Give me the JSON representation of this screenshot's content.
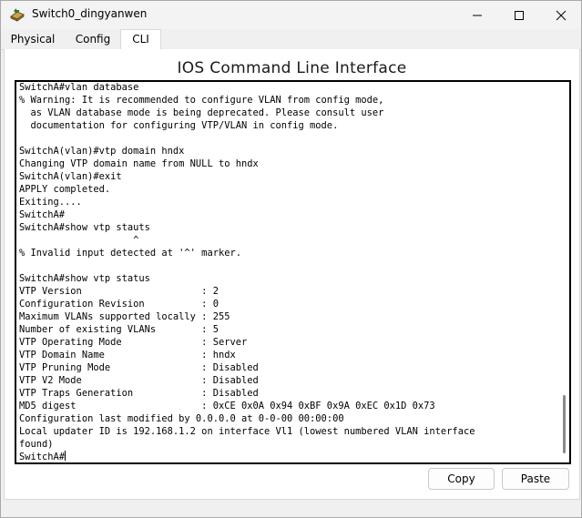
{
  "window": {
    "title": "Switch0_dingyanwen"
  },
  "tabs": [
    {
      "label": "Physical"
    },
    {
      "label": "Config"
    },
    {
      "label": "CLI"
    }
  ],
  "main": {
    "heading": "IOS Command Line Interface",
    "terminal_lines": [
      "SwitchA#vlan database",
      "% Warning: It is recommended to configure VLAN from config mode,",
      "  as VLAN database mode is being deprecated. Please consult user",
      "  documentation for configuring VTP/VLAN in config mode.",
      "",
      "SwitchA(vlan)#vtp domain hndx",
      "Changing VTP domain name from NULL to hndx",
      "SwitchA(vlan)#exit",
      "APPLY completed.",
      "Exiting....",
      "SwitchA#",
      "SwitchA#show vtp stauts",
      "                    ^",
      "% Invalid input detected at '^' marker.",
      "",
      "SwitchA#show vtp status",
      "VTP Version                     : 2",
      "Configuration Revision          : 0",
      "Maximum VLANs supported locally : 255",
      "Number of existing VLANs        : 5",
      "VTP Operating Mode              : Server",
      "VTP Domain Name                 : hndx",
      "VTP Pruning Mode                : Disabled",
      "VTP V2 Mode                     : Disabled",
      "VTP Traps Generation            : Disabled",
      "MD5 digest                      : 0xCE 0x0A 0x94 0xBF 0x9A 0xEC 0x1D 0x73",
      "Configuration last modified by 0.0.0.0 at 0-0-00 00:00:00",
      "Local updater ID is 192.168.1.2 on interface Vl1 (lowest numbered VLAN interface",
      "found)"
    ],
    "prompt": "SwitchA#"
  },
  "buttons": {
    "copy": "Copy",
    "paste": "Paste"
  },
  "icons": {
    "app": "switch-icon",
    "minimize": "minimize-icon",
    "maximize": "maximize-icon",
    "close": "close-icon"
  }
}
